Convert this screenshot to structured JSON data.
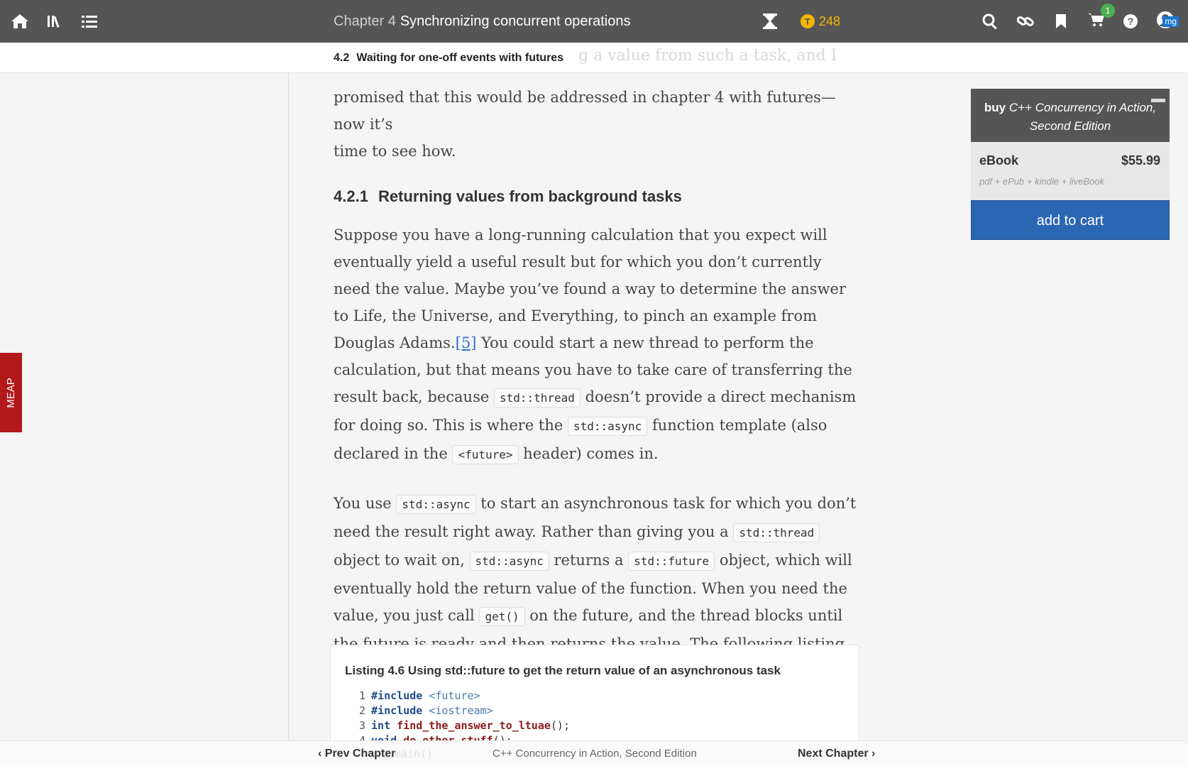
{
  "topbar": {
    "chapter_number": "Chapter 4",
    "chapter_title": "Synchronizing concurrent operations",
    "token_count": "248",
    "cart_count": "1",
    "avatar_initials": "mg",
    "icons": [
      "home-icon",
      "library-icon",
      "toc-list-icon",
      "hourglass-icon",
      "token-coin-icon",
      "search-icon",
      "link-icon",
      "bookmark-icon",
      "cart-icon",
      "help-icon",
      "user-avatar-icon"
    ]
  },
  "section": {
    "number": "4.2",
    "title": "Waiting for one-off events with futures",
    "ghost_text": "g a value from such a task, and I"
  },
  "content": {
    "intro_line1": "promised that this would be addressed in chapter 4 with futures—now it’s",
    "intro_line2": "time to see how.",
    "subsection_number": "4.2.1",
    "subsection_title": "Returning values from background tasks",
    "p1_a": "Suppose you have a long-running calculation that you expect will eventually yield a useful result but for which you don’t currently need the value. Maybe you’ve found a way to determine the answer to Life, the Universe, and Everything, to pinch an example from Douglas Adams.",
    "p1_footnote": "[5]",
    "p1_b": " You could start a new thread to perform the calculation, but that means you have to take care of transferring the result back, because ",
    "p1_code1": "std::thread",
    "p1_c": " doesn’t provide a direct mechanism for doing so. This is where the ",
    "p1_code2": "std::async",
    "p1_d": " function template (also declared in the ",
    "p1_code3": "<future>",
    "p1_e": " header) comes in.",
    "p2_a": "You use ",
    "p2_code1": "std::async",
    "p2_b": " to start an asynchronous task for which you don’t need the result right away. Rather than giving you a ",
    "p2_code2": "std::thread",
    "p2_c": " object to wait on, ",
    "p2_code3": "std::async",
    "p2_d": " returns a ",
    "p2_code4": "std::future",
    "p2_e": " object, which will eventually hold the return value of the function. When you need the value, you just call ",
    "p2_code5": "get()",
    "p2_f": " on the future, and the thread blocks until the future is ready and then returns the value. The following listing shows a simple example."
  },
  "listing": {
    "caption": "Listing 4.6 Using std::future to get the return value of an asynchronous task",
    "lines": [
      {
        "n": "1",
        "kw": "#include",
        "rest": " <future>"
      },
      {
        "n": "2",
        "kw": "#include",
        "rest": " <iostream>"
      },
      {
        "n": "3",
        "kw": "int",
        "fn": " find_the_answer_to_ltuae",
        "rest": "();"
      },
      {
        "n": "4",
        "kw": "void",
        "fn": " do_other_stuff",
        "rest": "();"
      }
    ],
    "ghost_line": "main()"
  },
  "meap_label": "MEAP",
  "buy_panel": {
    "buy_label": "buy",
    "book_title": "C++ Concurrency in Action, Second Edition",
    "ebook_label": "eBook",
    "price": "$55.99",
    "formats": "pdf + ePub + kindle + liveBook",
    "add_to_cart": "add to cart"
  },
  "bottombar": {
    "prev": "Prev Chapter",
    "book_title": "C++ Concurrency in Action, Second Edition",
    "next": "Next Chapter"
  }
}
